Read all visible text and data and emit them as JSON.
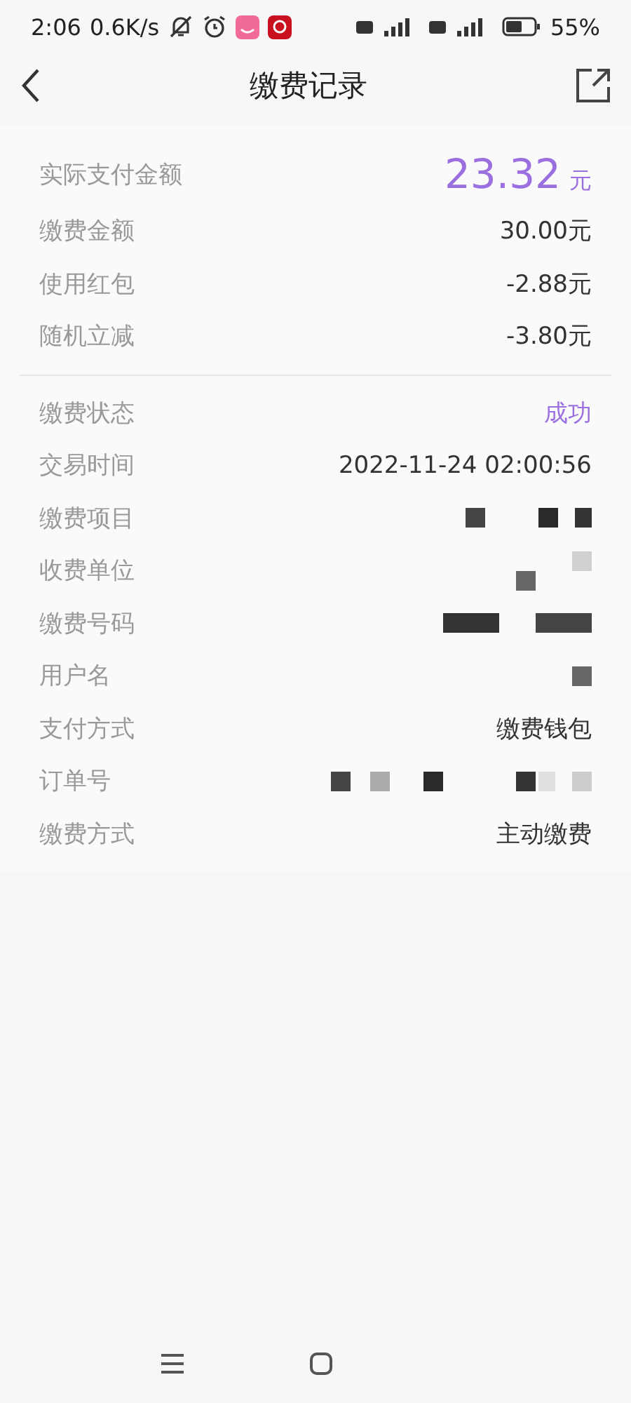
{
  "status_bar": {
    "time": "2:06",
    "speed": "0.6K/s",
    "battery": "55%"
  },
  "header": {
    "title": "缴费记录"
  },
  "summary": [
    {
      "kind": "amount",
      "label": "实际支付金额",
      "value": "23.32",
      "unit": "元"
    },
    {
      "kind": "text",
      "label": "缴费金额",
      "value": "30.00元"
    },
    {
      "kind": "text",
      "label": "使用红包",
      "value": "-2.88元"
    },
    {
      "kind": "text",
      "label": "随机立减",
      "value": "-3.80元"
    }
  ],
  "details": [
    {
      "kind": "status",
      "label": "缴费状态",
      "value": "成功"
    },
    {
      "kind": "text",
      "label": "交易时间",
      "value": "2022-11-24 02:00:56"
    },
    {
      "kind": "redacted",
      "label": "缴费项目"
    },
    {
      "kind": "redacted",
      "label": "收费单位"
    },
    {
      "kind": "redacted",
      "label": "缴费号码"
    },
    {
      "kind": "redacted",
      "label": "用户名"
    },
    {
      "kind": "text",
      "label": "支付方式",
      "value": "缴费钱包"
    },
    {
      "kind": "redacted",
      "label": "订单号"
    },
    {
      "kind": "text",
      "label": "缴费方式",
      "value": "主动缴费"
    }
  ]
}
